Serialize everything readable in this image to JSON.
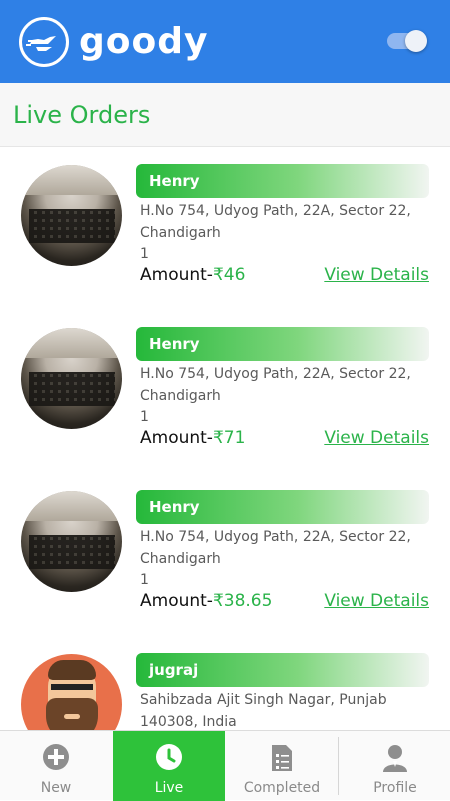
{
  "app": {
    "name": "goody"
  },
  "page": {
    "title": "Live Orders"
  },
  "orders": [
    {
      "name": "Henry",
      "address": "H.No 754, Udyog Path, 22A, Sector 22, Chandigarh",
      "quantity": "1",
      "amount_label": "Amount-",
      "amount": "₹46",
      "link": "View Details",
      "avatar": "laptop-photo"
    },
    {
      "name": "Henry",
      "address": "H.No 754, Udyog Path, 22A, Sector 22, Chandigarh",
      "quantity": "1",
      "amount_label": "Amount-",
      "amount": "₹71",
      "link": "View Details",
      "avatar": "laptop-photo"
    },
    {
      "name": "Henry",
      "address": "H.No 754, Udyog Path, 22A, Sector 22, Chandigarh",
      "quantity": "1",
      "amount_label": "Amount-",
      "amount": "₹38.65",
      "link": "View Details",
      "avatar": "laptop-photo"
    },
    {
      "name": "jugraj",
      "address": "Sahibzada Ajit Singh Nagar, Punjab 140308, India",
      "quantity": "",
      "amount_label": "",
      "amount": "",
      "link": "",
      "avatar": "bearded-man-illustration"
    }
  ],
  "nav": {
    "items": [
      {
        "label": "New",
        "icon": "plus-circle-icon"
      },
      {
        "label": "Live",
        "icon": "clock-icon"
      },
      {
        "label": "Completed",
        "icon": "checklist-icon"
      },
      {
        "label": "Profile",
        "icon": "person-icon"
      }
    ],
    "active": "Live"
  },
  "colors": {
    "primary": "#2f80e6",
    "accent": "#2bb34a",
    "active_tab": "#2ec23a"
  }
}
